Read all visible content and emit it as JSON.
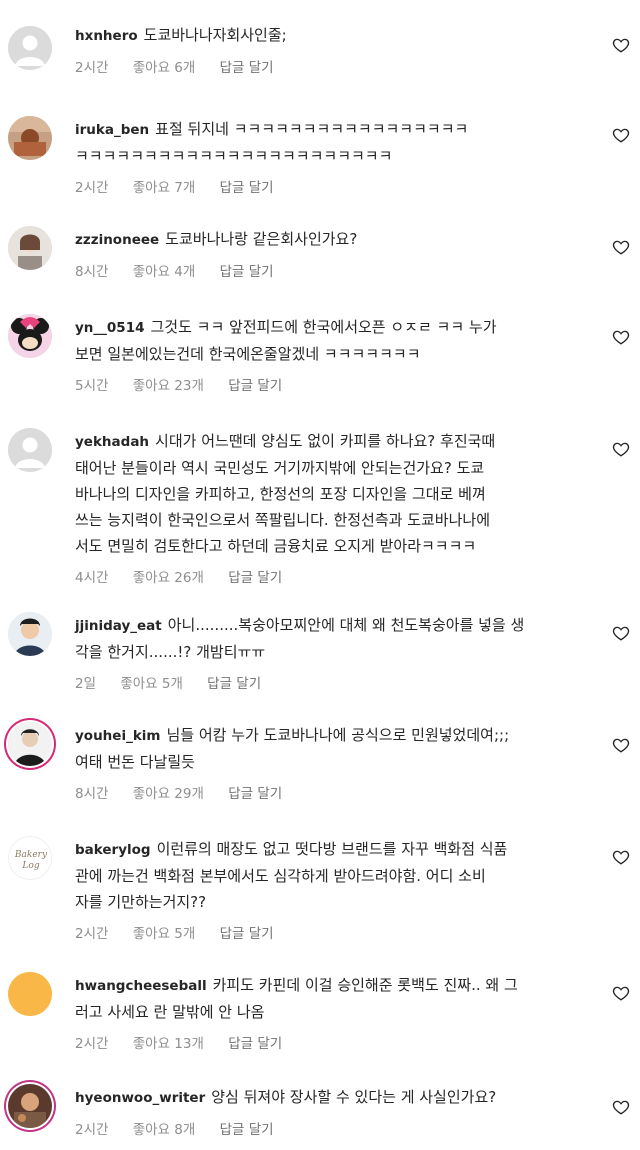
{
  "comments": [
    {
      "username": "hxnhero",
      "lines": [
        "도쿄바나나자회사인줄;"
      ],
      "time": "2시간",
      "likes": "좋아요 6개",
      "reply": "답글 달기",
      "avatar": "default-avatar-icon"
    },
    {
      "username": "iruka_ben",
      "lines": [
        "표절 뒤지네 ㅋㅋㅋㅋㅋㅋㅋㅋㅋㅋㅋㅋㅋㅋㅋㅋㅋ",
        "ㅋㅋㅋㅋㅋㅋㅋㅋㅋㅋㅋㅋㅋㅋㅋㅋㅋㅋㅋㅋㅋㅋㅋ"
      ],
      "time": "2시간",
      "likes": "좋아요 7개",
      "reply": "답글 달기",
      "avatar": "photo-avatar-icon"
    },
    {
      "username": "zzzinoneee",
      "lines": [
        "도쿄바나나랑 같은회사인가요?"
      ],
      "time": "8시간",
      "likes": "좋아요 4개",
      "reply": "답글 달기",
      "avatar": "photo-avatar-icon"
    },
    {
      "username": "yn__0514",
      "lines": [
        "그것도 ㅋㅋ 앞전피드에 한국에서오픈 ㅇㅈㄹ ㅋㅋ 누가",
        "보면 일본에있는건데 한국에온줄알겠네 ㅋㅋㅋㅋㅋㅋㅋ"
      ],
      "time": "5시간",
      "likes": "좋아요 23개",
      "reply": "답글 달기",
      "avatar": "cartoon-avatar-icon"
    },
    {
      "username": "yekhadah",
      "lines": [
        "시대가 어느땐데 양심도 없이 카피를 하나요? 후진국때",
        "태어난 분들이라 역시 국민성도 거기까지밖에 안되는건가요? 도쿄",
        "바나나의 디자인을 카피하고, 한정선의 포장 디자인을 그대로 베껴",
        "쓰는 능지력이 한국인으로서 쪽팔립니다. 한정선측과 도쿄바나나에",
        "서도 면밀히 검토한다고 하던데 금융치료 오지게 받아라ㅋㅋㅋㅋ"
      ],
      "time": "4시간",
      "likes": "좋아요 26개",
      "reply": "답글 달기",
      "avatar": "default-avatar-icon"
    },
    {
      "username": "jjiniday_eat",
      "lines": [
        "아니.........복숭아모찌안에 대체 왜 천도복숭아를 넣을 생",
        "각을 한거지......!? 개밤티ㅠㅠ"
      ],
      "time": "2일",
      "likes": "좋아요 5개",
      "reply": "답글 달기",
      "avatar": "photo-avatar-icon"
    },
    {
      "username": "youhei_kim",
      "lines": [
        "님들 어캄 누가 도쿄바나나에 공식으로 민원넣었데여;;;",
        "여태 번돈 다날릴듯"
      ],
      "time": "8시간",
      "likes": "좋아요 29개",
      "reply": "답글 달기",
      "avatar": "photo-avatar-icon"
    },
    {
      "username": "bakerylog",
      "lines": [
        "이런류의 매장도 없고 떳다방 브랜드를 자꾸 백화점 식품",
        "관에 까는건 백화점 본부에서도 심각하게 받아드려야함. 어디 소비",
        "자를 기만하는거지??"
      ],
      "time": "2시간",
      "likes": "좋아요 5개",
      "reply": "답글 달기",
      "avatar": "logo-avatar-icon",
      "avatar_text": "Bakery Log"
    },
    {
      "username": "hwangcheeseball",
      "lines": [
        "카피도 카핀데 이걸 승인해준 롯백도 진짜.. 왜 그",
        "러고 사세요 란 말밖에 안 나옴"
      ],
      "time": "2시간",
      "likes": "좋아요 13개",
      "reply": "답글 달기",
      "avatar": "solid-avatar-icon"
    },
    {
      "username": "hyeonwoo_writer",
      "lines": [
        "양심 뒤져야 장사할 수 있다는 게 사실인가요?"
      ],
      "time": "2시간",
      "likes": "좋아요 8개",
      "reply": "답글 달기",
      "avatar": "photo-avatar-icon"
    }
  ],
  "colors": {
    "text": "#262626",
    "meta": "#8e8e8e",
    "avatar_default_bg": "#dbdbdb",
    "avatar_solid": "#f9b748"
  }
}
